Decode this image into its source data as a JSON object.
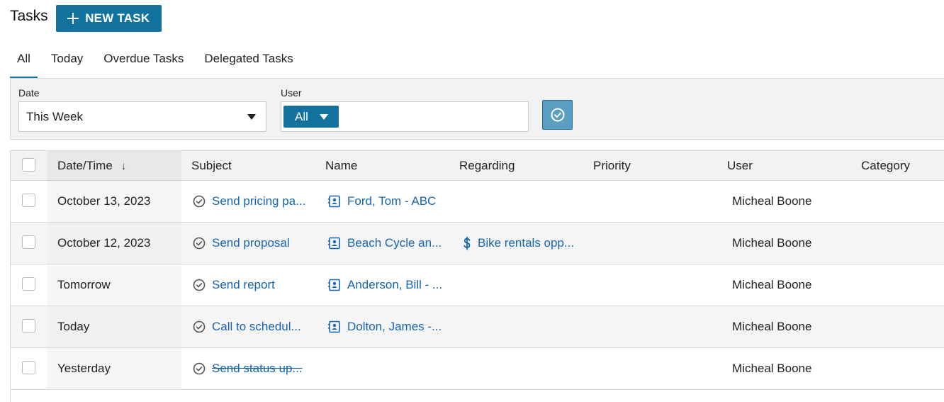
{
  "header": {
    "title": "Tasks",
    "new_task_label": "NEW TASK"
  },
  "tabs": [
    {
      "label": "All",
      "active": true
    },
    {
      "label": "Today",
      "active": false
    },
    {
      "label": "Overdue Tasks",
      "active": false
    },
    {
      "label": "Delegated Tasks",
      "active": false
    }
  ],
  "filters": {
    "date_label": "Date",
    "date_value": "This Week",
    "user_label": "User",
    "user_value": "All"
  },
  "table": {
    "columns": [
      "Date/Time",
      "Subject",
      "Name",
      "Regarding",
      "Priority",
      "User",
      "Category"
    ],
    "sort_indicator": "↓",
    "rows": [
      {
        "date": "October 13, 2023",
        "subject": "Send pricing pa...",
        "name": "Ford, Tom - ABC",
        "regarding": "",
        "priority": "",
        "user": "Micheal Boone",
        "category": "",
        "completed": false
      },
      {
        "date": "October 12, 2023",
        "subject": "Send proposal",
        "name": "Beach Cycle an...",
        "regarding": "Bike rentals opp...",
        "priority": "",
        "user": "Micheal Boone",
        "category": "",
        "completed": false
      },
      {
        "date": "Tomorrow",
        "subject": "Send report",
        "name": "Anderson, Bill - ...",
        "regarding": "",
        "priority": "",
        "user": "Micheal Boone",
        "category": "",
        "completed": false
      },
      {
        "date": "Today",
        "subject": "Call to schedul...",
        "name": "Dolton, James -...",
        "regarding": "",
        "priority": "",
        "user": "Micheal Boone",
        "category": "",
        "completed": false
      },
      {
        "date": "Yesterday",
        "subject": "Send status up...",
        "name": "",
        "regarding": "",
        "priority": "",
        "user": "Micheal Boone",
        "category": "",
        "completed": true
      }
    ]
  },
  "icons": {
    "task": "check-circle-icon",
    "contact": "contact-card-icon",
    "opportunity": "dollar-icon",
    "apply": "check-circle-icon"
  },
  "colors": {
    "primary": "#14729f",
    "link": "#1565b0",
    "apply_button": "#5a9ec2"
  }
}
